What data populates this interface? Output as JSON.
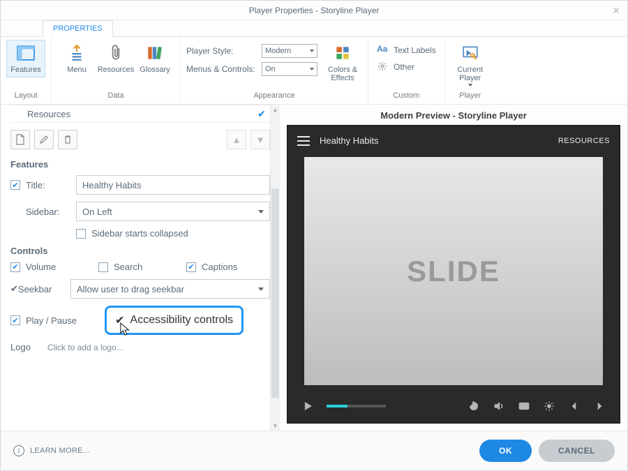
{
  "window": {
    "title": "Player Properties - Storyline Player"
  },
  "tabs": {
    "properties": "PROPERTIES"
  },
  "ribbon": {
    "layout": {
      "label": "Layout",
      "features": "Features"
    },
    "data": {
      "label": "Data",
      "menu": "Menu",
      "resources": "Resources",
      "glossary": "Glossary"
    },
    "appearance": {
      "label": "Appearance",
      "playerStyleLabel": "Player Style:",
      "playerStyleValue": "Modern",
      "menusControlsLabel": "Menus & Controls:",
      "menusControlsValue": "On",
      "colorsEffects": "Colors &\nEffects"
    },
    "custom": {
      "label": "Custom",
      "textLabels": "Text Labels",
      "other": "Other"
    },
    "player": {
      "label": "Player",
      "currentPlayer": "Current\nPlayer"
    }
  },
  "left": {
    "listItem": "Resources",
    "sections": {
      "features": "Features",
      "controls": "Controls"
    },
    "titleLabel": "Title:",
    "titleValue": "Healthy Habits",
    "sidebarLabel": "Sidebar:",
    "sidebarValue": "On Left",
    "sidebarCollapsed": "Sidebar starts collapsed",
    "volume": "Volume",
    "search": "Search",
    "captions": "Captions",
    "seekbar": "Seekbar",
    "seekbarMode": "Allow user to drag seekbar",
    "playPause": "Play / Pause",
    "accessibility": "Accessibility controls",
    "logo": "Logo",
    "addLogo": "Click to add a logo..."
  },
  "preview": {
    "label": "Modern Preview - Storyline Player",
    "courseTitle": "Healthy Habits",
    "resources": "RESOURCES",
    "slideText": "SLIDE"
  },
  "footer": {
    "learn": "LEARN MORE...",
    "ok": "OK",
    "cancel": "CANCEL"
  },
  "state": {
    "titleChecked": true,
    "sidebarCollapsedChecked": false,
    "volumeChecked": true,
    "searchChecked": false,
    "captionsChecked": true,
    "seekbarChecked": true,
    "playPauseChecked": true,
    "accessibilityChecked": true,
    "logoChecked": false
  }
}
